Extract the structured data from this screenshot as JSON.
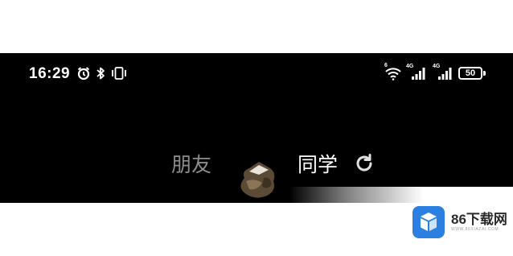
{
  "status_bar": {
    "time": "16:29",
    "icons": [
      "alarm-icon",
      "bluetooth-icon",
      "vibrate-icon",
      "wifi-icon",
      "signal-icon",
      "signal-icon"
    ],
    "wifi_label": "6",
    "net1_label": "4G",
    "net2_label": "4G",
    "battery_level": "50"
  },
  "tabs": [
    {
      "label": "朋友",
      "active": false
    },
    {
      "label": "同学",
      "active": true
    }
  ],
  "watermark": {
    "title": "86下载网",
    "url": "WWW.86XIAZAI.COM"
  },
  "colors": {
    "background": "#000000",
    "tab_active": "#ffffff",
    "tab_inactive": "#8d8d8d",
    "watermark_blue": "#2a7fe0"
  }
}
